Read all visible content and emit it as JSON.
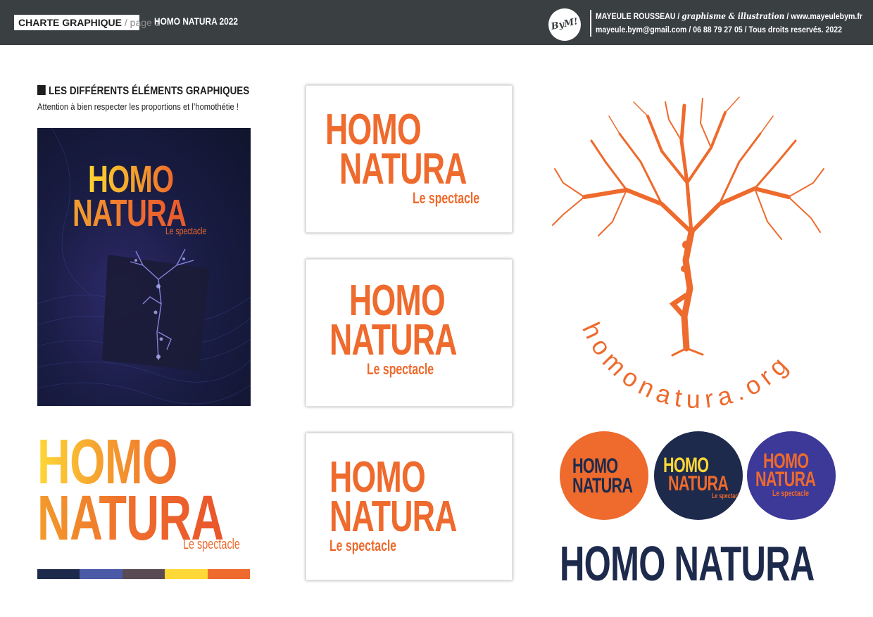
{
  "header": {
    "doc_label": "CHARTE GRAPHIQUE",
    "page_label": "/ page 1",
    "title": "HOMO NATURA 2022",
    "studio_logo": "ByM!",
    "credit_name": "MAYEULE ROUSSEAU /",
    "credit_role": "graphisme & illustration",
    "credit_site": "/ www.mayeulebym.fr",
    "credit_contact": "mayeule.bym@gmail.com / 06 88 79 27 05 / Tous droits reservés. 2022"
  },
  "section": {
    "title": "LES DIFFÉRENTS ÉLÉMENTS GRAPHIQUES",
    "subtitle": "Attention à bien respecter les proportions et l’homothétie !"
  },
  "logo": {
    "line1": "HOMO",
    "line2": "NATURA",
    "tagline": "Le spectacle",
    "wordmark": "HOMO NATURA",
    "url": "homonatura.org"
  },
  "colors": {
    "orange": "#ee6a2d",
    "yellow": "#fdd836",
    "navy": "#1d2a4c",
    "indigo": "#3c3998"
  },
  "palette": [
    "#1d2a4c",
    "#4a5aa6",
    "#5a4a53",
    "#fdd836",
    "#ee6a2d"
  ],
  "icons": [
    "square-bullet-icon",
    "tree-figure-icon"
  ]
}
